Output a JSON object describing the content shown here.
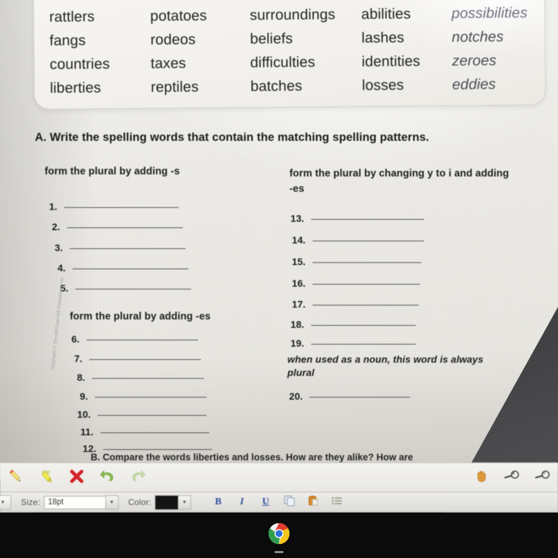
{
  "worksheet": {
    "word_bank": {
      "columns": [
        [
          "rattlers",
          "fangs",
          "countries",
          "liberties"
        ],
        [
          "potatoes",
          "rodeos",
          "taxes",
          "reptiles"
        ],
        [
          "surroundings",
          "beliefs",
          "difficulties",
          "batches"
        ],
        [
          "abilities",
          "lashes",
          "identities",
          "losses"
        ],
        [
          "possibilities",
          "notches",
          "zeroes",
          "eddies"
        ]
      ]
    },
    "prompt_a": "A. Write the spelling words that contain the matching spelling patterns.",
    "headings": {
      "left_s": "form the plural by adding -s",
      "left_es": "form the plural by adding -es",
      "right_y_to_i": "form the plural by changing y to i and adding -es",
      "right_noun": "when used as a noun, this word is always plural"
    },
    "numbers": {
      "left_s": [
        "1.",
        "2.",
        "3.",
        "4.",
        "5."
      ],
      "left_es": [
        "6.",
        "7.",
        "8.",
        "9.",
        "10.",
        "11.",
        "12."
      ],
      "right_y_to_i": [
        "13.",
        "14.",
        "15.",
        "16.",
        "17.",
        "18.",
        "19."
      ],
      "right_noun": [
        "20."
      ]
    },
    "prompt_b": "B. Compare the words liberties and losses. How are they alike? How are",
    "copyright": "Copyright © The McGraw-Hill Companies, Inc."
  },
  "toolbar": {
    "tools": [
      {
        "name": "pencil-icon",
        "label": "Pencil"
      },
      {
        "name": "highlighter-icon",
        "label": "Highlighter"
      },
      {
        "name": "delete-icon",
        "label": "Delete"
      },
      {
        "name": "undo-icon",
        "label": "Undo"
      },
      {
        "name": "redo-icon",
        "label": "Redo"
      }
    ],
    "right_tools": [
      {
        "name": "pan-hand-icon",
        "label": "Pan"
      },
      {
        "name": "zoom-in-icon",
        "label": "Zoom in"
      },
      {
        "name": "zoom-out-icon",
        "label": "Zoom out"
      }
    ]
  },
  "format_bar": {
    "size_label": "Size:",
    "size_value": "18pt",
    "color_label": "Color:",
    "color_value": "#141414",
    "bold_label": "B",
    "italic_label": "I",
    "underline_label": "U",
    "copy_label": "Copy",
    "paste_label": "Paste",
    "list_label": "List",
    "dropdown_arrow": "▼"
  },
  "taskbar": {
    "apps": [
      {
        "name": "chrome-icon",
        "label": "Google Chrome",
        "running": true
      }
    ]
  }
}
